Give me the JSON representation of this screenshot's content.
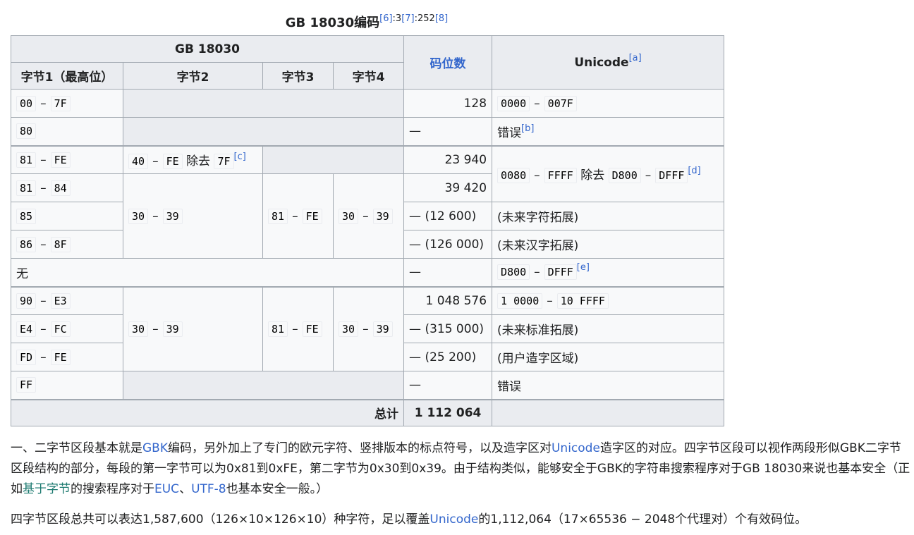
{
  "caption": {
    "title": "GB 18030编码",
    "ref1": "[6]",
    "ref1_page": ":3",
    "ref2": "[7]",
    "ref2_page": ":252",
    "ref3": "[8]"
  },
  "header": {
    "group": "GB 18030",
    "byte1": "字节1（最高位）",
    "byte2": "字节2",
    "byte3": "字节3",
    "byte4": "字节4",
    "codepoints": "码位数",
    "unicode": "Unicode",
    "unicode_note": "[a]"
  },
  "dash": "–",
  "rows": {
    "r1": {
      "b1_from": "00",
      "b1_to": "7F",
      "count": "128",
      "u_from": "0000",
      "u_to": "007F"
    },
    "r2": {
      "b1": "80",
      "count": "—",
      "unicode": "错误",
      "note": "[b]"
    },
    "r3": {
      "b1_from": "81",
      "b1_to": "FE",
      "b2_from": "40",
      "b2_to": "FE",
      "except": "除去",
      "b2_except": "7F",
      "b2_note": "[c]",
      "count": "23 940",
      "u_from": "0080",
      "u_to": "FFFF",
      "u_except": "除去",
      "u_ex_from": "D800",
      "u_ex_to": "DFFF",
      "u_note": "[d]"
    },
    "r4": {
      "b1_from": "81",
      "b1_to": "84",
      "b2_from": "30",
      "b2_to": "39",
      "b3_from": "81",
      "b3_to": "FE",
      "b4_from": "30",
      "b4_to": "39",
      "count": "39 420"
    },
    "r5": {
      "b1": "85",
      "count": "— (12 600)",
      "unicode": "(未来字符拓展)"
    },
    "r6": {
      "b1_from": "86",
      "b1_to": "8F",
      "count": "— (126 000)",
      "unicode": "(未来汉字拓展)"
    },
    "r7": {
      "b1": "无",
      "count": "—",
      "u_from": "D800",
      "u_to": "DFFF",
      "note": "[e]"
    },
    "r8": {
      "b1_from": "90",
      "b1_to": "E3",
      "b2_from": "30",
      "b2_to": "39",
      "b3_from": "81",
      "b3_to": "FE",
      "b4_from": "30",
      "b4_to": "39",
      "count": "1 048 576",
      "u_from": "1 0000",
      "u_to": "10 FFFF"
    },
    "r9": {
      "b1_from": "E4",
      "b1_to": "FC",
      "count": "— (315 000)",
      "unicode": "(未来标准拓展)"
    },
    "r10": {
      "b1_from": "FD",
      "b1_to": "FE",
      "count": "— (25 200)",
      "unicode": "(用户造字区域)"
    },
    "r11": {
      "b1": "FF",
      "count": "—",
      "unicode": "错误"
    },
    "total": {
      "label": "总计",
      "count": "1 112 064"
    }
  },
  "para1": {
    "t1": "一、二字节区段基本就是",
    "gbk": "GBK",
    "t2": "编码，另外加上了专门的欧元字符、竖排版本的标点符号，以及造字区对",
    "unicode": "Unicode",
    "t3": "造字区的对应。四字节区段可以视作两段形似GBK二字节区段结构的部分，每段的第一字节可以为0x81到0xFE，第二字节为0x30到0x39。由于结构类似，能够安全于GBK的字符串搜索程序对于GB 18030来说也基本安全（正如",
    "byte_based": "基于字节",
    "t4": "的搜索程序对于",
    "euc": "EUC",
    "t5": "、",
    "utf8": "UTF-8",
    "t6": "也基本安全一般。）"
  },
  "para2": {
    "t1": "四字节区段总共可以表达1,587,600（126×10×126×10）种字符，足以覆盖",
    "unicode": "Unicode",
    "t2": "的1,112,064（17×65536 − 2048个代理对）个有效码位。"
  },
  "colors": {
    "link": "#3366cc",
    "visited_link": "#1d7a70",
    "header_bg": "#eaecf0",
    "cell_bg": "#f8f9fa",
    "border": "#a2a9b1"
  }
}
